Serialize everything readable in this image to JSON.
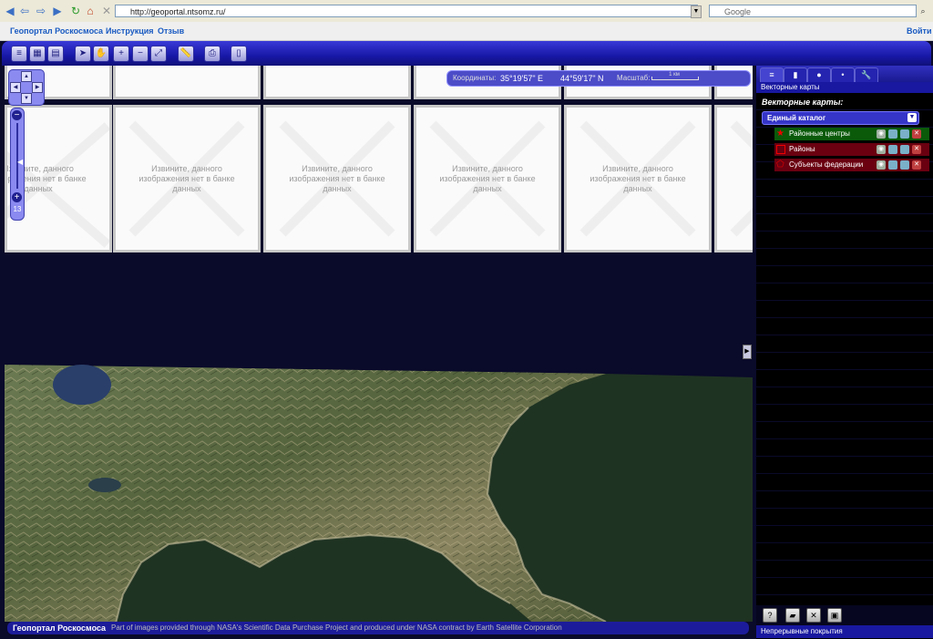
{
  "browser": {
    "url": "http://geoportal.ntsomz.ru/",
    "search_placeholder": "Google"
  },
  "header": {
    "title": "Геопортал Роскосмоса",
    "links": [
      "Инструкция",
      "Отзыв"
    ],
    "login": "Войти"
  },
  "map": {
    "tile_message_lines": [
      "Извините, данного",
      "изображения нет в банке",
      "данных"
    ],
    "zoom_level": "13",
    "coords": {
      "label": "Координаты:",
      "lon": "35°19'57\" E",
      "lat": "44°59'17\" N",
      "scale_label": "Масштаб:",
      "scale_value": "1 км"
    },
    "footer": {
      "brand": "Геопортал Роскосмоса",
      "credit": "Part of images provided through NASA's Scientific Data Purchase Project and produced under NASA contract by Earth Satellite Corporation"
    }
  },
  "panel": {
    "title": "Векторные карты",
    "vector_label": "Векторные карты:",
    "catalog": "Единый каталог",
    "layers": [
      {
        "name": "Районные центры",
        "color": "#0a5a0a",
        "icon": "star-icon"
      },
      {
        "name": "Районы",
        "color": "#6a0010",
        "icon": "polygon-icon"
      },
      {
        "name": "Субъекты федерации",
        "color": "#6a0010",
        "icon": "region-icon"
      }
    ],
    "footer": "Непрерывные покрытия"
  }
}
